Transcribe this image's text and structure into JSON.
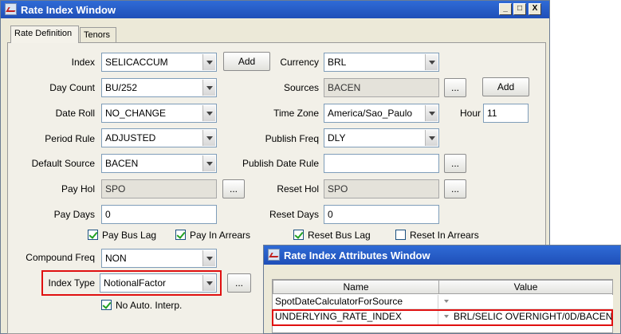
{
  "main_window": {
    "title": "Rate Index Window",
    "controls": {
      "minimize": "_",
      "maximize": "□",
      "close": "X"
    },
    "tabs": [
      {
        "label": "Rate Definition",
        "active": true
      },
      {
        "label": "Tenors",
        "active": false
      }
    ]
  },
  "form": {
    "index": {
      "label": "Index",
      "value": "SELICACCUM",
      "add_label": "Add"
    },
    "currency": {
      "label": "Currency",
      "value": "BRL"
    },
    "day_count": {
      "label": "Day Count",
      "value": "BU/252"
    },
    "sources": {
      "label": "Sources",
      "value": "BACEN",
      "browse_label": "...",
      "add_label": "Add"
    },
    "date_roll": {
      "label": "Date Roll",
      "value": "NO_CHANGE"
    },
    "time_zone": {
      "label": "Time Zone",
      "value": "America/Sao_Paulo"
    },
    "hour": {
      "label": "Hour",
      "value": "11"
    },
    "period_rule": {
      "label": "Period Rule",
      "value": "ADJUSTED"
    },
    "publish_freq": {
      "label": "Publish Freq",
      "value": "DLY"
    },
    "default_source": {
      "label": "Default Source",
      "value": "BACEN"
    },
    "publish_date_rule": {
      "label": "Publish Date Rule",
      "value": "",
      "browse_label": "..."
    },
    "pay_hol": {
      "label": "Pay Hol",
      "value": "SPO",
      "browse_label": "..."
    },
    "reset_hol": {
      "label": "Reset Hol",
      "value": "SPO",
      "browse_label": "..."
    },
    "pay_days": {
      "label": "Pay Days",
      "value": "0"
    },
    "reset_days": {
      "label": "Reset Days",
      "value": "0"
    },
    "pay_bus_lag": {
      "label": "Pay Bus Lag",
      "checked": true
    },
    "pay_in_arrears": {
      "label": "Pay In Arrears",
      "checked": true
    },
    "reset_bus_lag": {
      "label": "Reset Bus Lag",
      "checked": true
    },
    "reset_in_arrears": {
      "label": "Reset In Arrears",
      "checked": false
    },
    "compound_freq": {
      "label": "Compound Freq",
      "value": "NON"
    },
    "index_type": {
      "label": "Index Type",
      "value": "NotionalFactor",
      "browse_label": "..."
    },
    "no_auto_interp": {
      "label": "No Auto. Interp.",
      "checked": true
    }
  },
  "attributes_window": {
    "title": "Rate Index Attributes Window",
    "columns": {
      "name": "Name",
      "value": "Value"
    },
    "rows": [
      {
        "name": "SpotDateCalculatorForSource",
        "value": ""
      },
      {
        "name": "UNDERLYING_RATE_INDEX",
        "value": "BRL/SELIC OVERNIGHT/0D/BACEN"
      }
    ]
  },
  "colors": {
    "title_bar": "#2f6bd6",
    "highlight": "#e01010",
    "check": "#21a121"
  }
}
